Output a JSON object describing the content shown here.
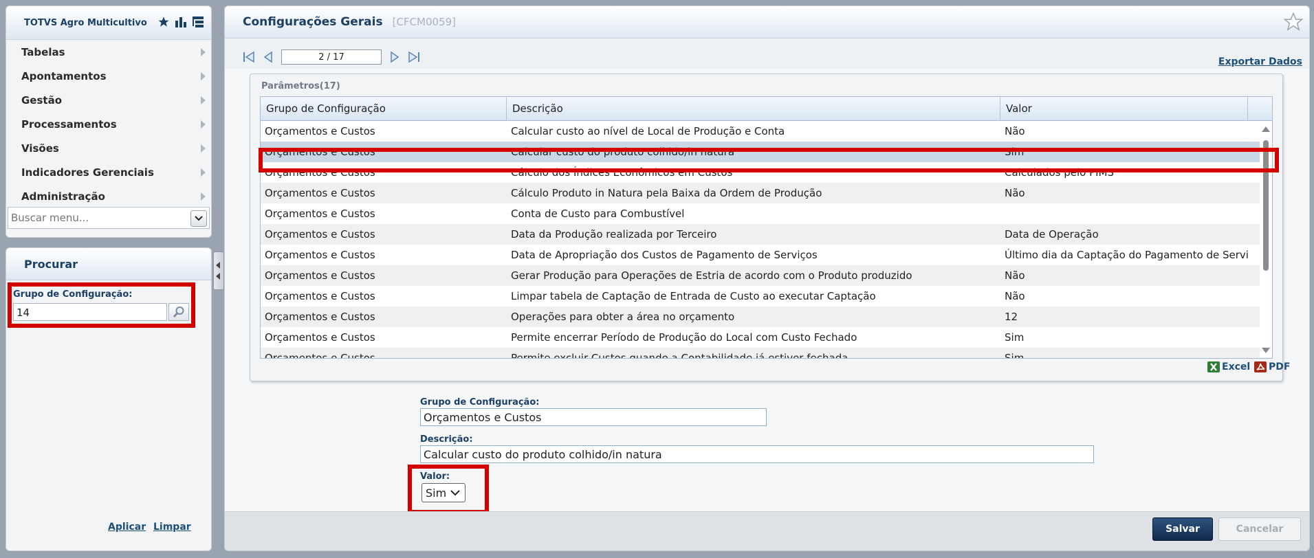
{
  "app": {
    "title": "TOTVS Agro Multicultivo"
  },
  "menu": {
    "items": [
      {
        "label": "Tabelas"
      },
      {
        "label": "Apontamentos"
      },
      {
        "label": "Gestão"
      },
      {
        "label": "Processamentos"
      },
      {
        "label": "Visões"
      },
      {
        "label": "Indicadores Gerenciais"
      },
      {
        "label": "Administração"
      }
    ],
    "search_placeholder": "Buscar menu..."
  },
  "procurar": {
    "title": "Procurar",
    "group_label": "Grupo de Configuração:",
    "group_value": "14",
    "apply_label": "Aplicar",
    "clear_label": "Limpar"
  },
  "page": {
    "title": "Configurações Gerais",
    "code": "[CFCM0059]",
    "pager": "2 / 17",
    "export_label": "Exportar Dados"
  },
  "grid": {
    "caption": "Parâmetros(17)",
    "columns": [
      "Grupo de Configuração",
      "Descrição",
      "Valor"
    ],
    "rows": [
      {
        "grupo": "Orçamentos e Custos",
        "descricao": "Calcular custo ao nível de Local de Produção e Conta",
        "valor": "Não"
      },
      {
        "grupo": "Orçamentos e Custos",
        "descricao": "Calcular custo do produto colhido/in natura",
        "valor": "Sim"
      },
      {
        "grupo": "Orçamentos e Custos",
        "descricao": "Cálculo dos Índices Econômicos em Custos",
        "valor": "Calculados pelo PIMS"
      },
      {
        "grupo": "Orçamentos e Custos",
        "descricao": "Cálculo Produto in Natura pela Baixa da Ordem de Produção",
        "valor": "Não"
      },
      {
        "grupo": "Orçamentos e Custos",
        "descricao": "Conta de Custo para Combustível",
        "valor": ""
      },
      {
        "grupo": "Orçamentos e Custos",
        "descricao": "Data da Produção realizada por Terceiro",
        "valor": "Data de Operação"
      },
      {
        "grupo": "Orçamentos e Custos",
        "descricao": "Data de Apropriação dos Custos de Pagamento de Serviços",
        "valor": "Último dia da Captação do Pagamento de Serviço"
      },
      {
        "grupo": "Orçamentos e Custos",
        "descricao": "Gerar Produção para Operações de Estria de acordo com o Produto produzido",
        "valor": "Não"
      },
      {
        "grupo": "Orçamentos e Custos",
        "descricao": "Limpar tabela de Captação de Entrada de Custo ao executar Captação",
        "valor": "Não"
      },
      {
        "grupo": "Orçamentos e Custos",
        "descricao": "Operações para obter a área no orçamento",
        "valor": "12"
      },
      {
        "grupo": "Orçamentos e Custos",
        "descricao": "Permite encerrar Período de Produção do Local com Custo Fechado",
        "valor": "Sim"
      },
      {
        "grupo": "Orçamentos e Custos",
        "descricao": "Permite excluir Custos quando a Contabilidade já estiver fechada",
        "valor": "Sim"
      }
    ],
    "excel_label": "Excel",
    "pdf_label": "PDF"
  },
  "form": {
    "group_label": "Grupo de Configuração:",
    "group_value": "Orçamentos e Custos",
    "desc_label": "Descrição:",
    "desc_value": "Calcular custo do produto colhido/in natura",
    "valor_label": "Valor:",
    "valor_value": "Sim"
  },
  "actions": {
    "save_label": "Salvar",
    "cancel_label": "Cancelar"
  },
  "colors": {
    "highlight": "#d40000",
    "accent": "#1c3f66"
  }
}
